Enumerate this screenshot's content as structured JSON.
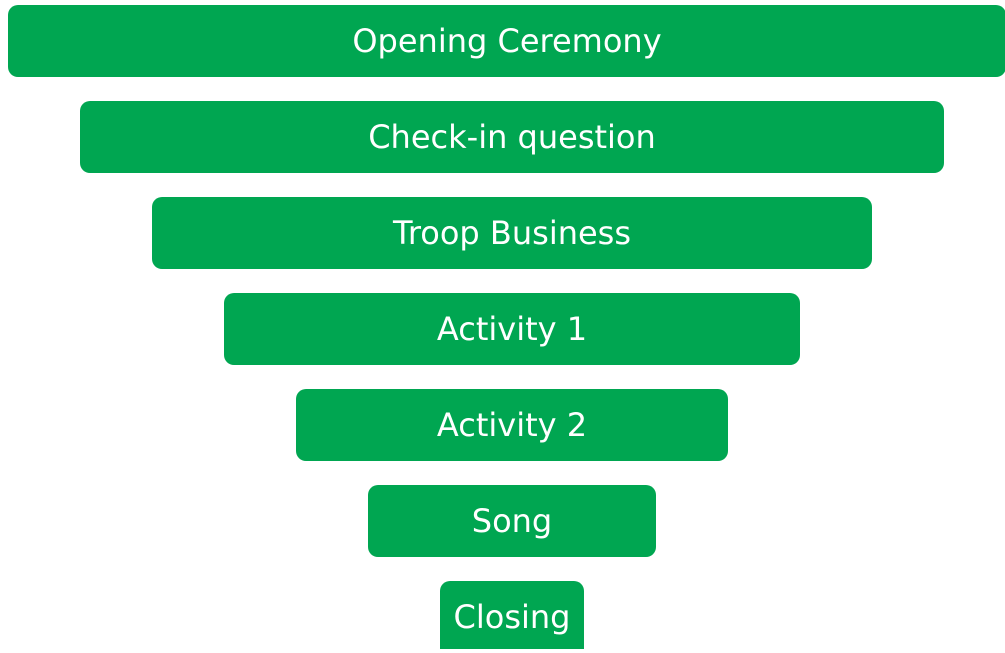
{
  "diagram": {
    "type": "funnel",
    "fill_color": "#00a651",
    "text_color": "#ffffff",
    "steps": [
      {
        "label": "Opening Ceremony"
      },
      {
        "label": "Check-in question"
      },
      {
        "label": "Troop Business"
      },
      {
        "label": "Activity 1"
      },
      {
        "label": "Activity 2"
      },
      {
        "label": "Song"
      },
      {
        "label": "Closing"
      }
    ]
  }
}
